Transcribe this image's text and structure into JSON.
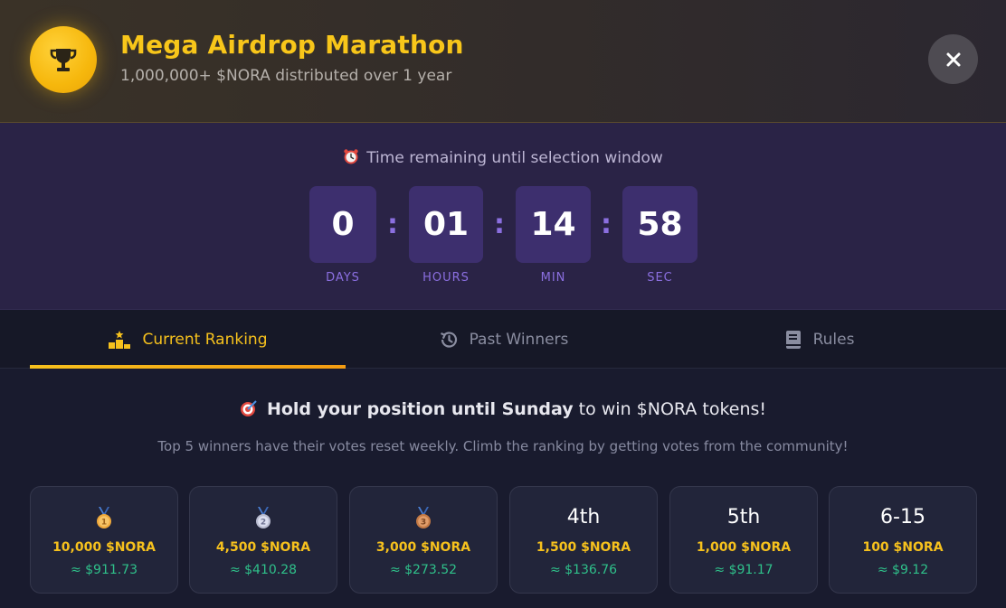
{
  "header": {
    "title": "Mega Airdrop Marathon",
    "subtitle": "1,000,000+ $NORA distributed over 1 year",
    "close_icon": "close-icon",
    "trophy_icon": "trophy-icon"
  },
  "countdown": {
    "heading": "Time remaining until selection window",
    "units": [
      {
        "value": "0",
        "label": "DAYS"
      },
      {
        "value": "01",
        "label": "HOURS"
      },
      {
        "value": "14",
        "label": "MIN"
      },
      {
        "value": "58",
        "label": "SEC"
      }
    ],
    "separator": ":"
  },
  "tabs": [
    {
      "label": "Current Ranking",
      "icon": "podium-icon",
      "active": true
    },
    {
      "label": "Past Winners",
      "icon": "history-icon",
      "active": false
    },
    {
      "label": "Rules",
      "icon": "book-icon",
      "active": false
    }
  ],
  "promo": {
    "bold": "Hold your position until Sunday",
    "rest": " to win $NORA tokens!",
    "note": "Top 5 winners have their votes reset weekly. Climb the ranking by getting votes from the community!"
  },
  "prizes": [
    {
      "rank": "",
      "medal": "gold",
      "medal_num": "1",
      "amount": "10,000 $NORA",
      "usd": "≈ $911.73"
    },
    {
      "rank": "",
      "medal": "silver",
      "medal_num": "2",
      "amount": "4,500 $NORA",
      "usd": "≈ $410.28"
    },
    {
      "rank": "",
      "medal": "bronze",
      "medal_num": "3",
      "amount": "3,000 $NORA",
      "usd": "≈ $273.52"
    },
    {
      "rank": "4th",
      "medal": "",
      "amount": "1,500 $NORA",
      "usd": "≈ $136.76"
    },
    {
      "rank": "5th",
      "medal": "",
      "amount": "1,000 $NORA",
      "usd": "≈ $91.17"
    },
    {
      "rank": "6-15",
      "medal": "",
      "amount": "100 $NORA",
      "usd": "≈ $9.12"
    }
  ],
  "colors": {
    "accent": "#f6c11d",
    "purple": "#8b6fe0",
    "usd_green": "#2fc08a"
  }
}
